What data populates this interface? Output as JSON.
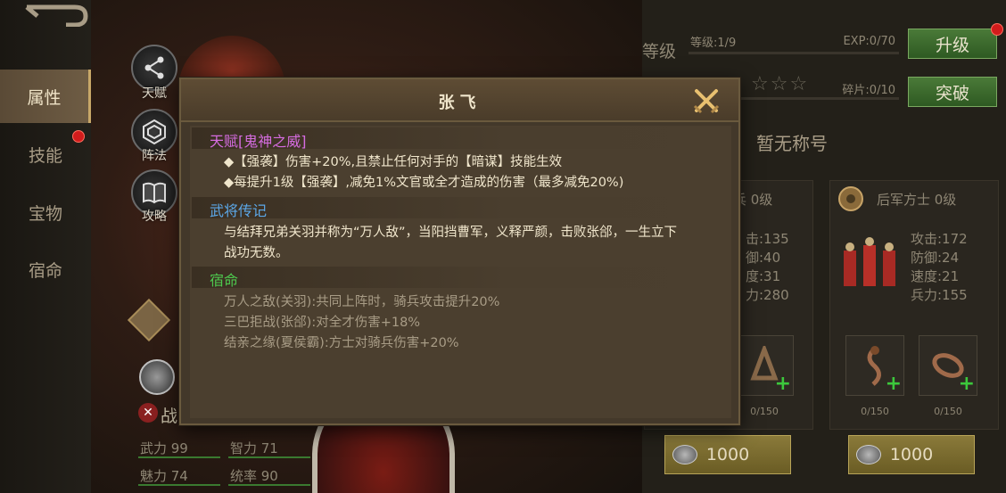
{
  "left_nav": {
    "tabs": [
      {
        "label": "属性",
        "active": true
      },
      {
        "label": "技能",
        "badge": true
      },
      {
        "label": "宝物"
      },
      {
        "label": "宿命"
      }
    ]
  },
  "round_buttons": [
    {
      "label": "天赋",
      "icon": "share-icon"
    },
    {
      "label": "阵法",
      "icon": "hexagon-icon"
    },
    {
      "label": "攻略",
      "icon": "book-icon"
    }
  ],
  "header": {
    "level_label": "等级",
    "level_value": "等级:1/9",
    "exp_value": "EXP:0/70",
    "fragments_value": "碎片:0/10",
    "upgrade_button": "升级",
    "breakthrough_button": "突破",
    "stars_filled": 0,
    "title_text": "暂无称号"
  },
  "troops": [
    {
      "name": "兵 0级",
      "stats": [
        "击:135",
        "御:40",
        "度:31",
        "力:280"
      ],
      "equip_counts": [
        "0/150"
      ],
      "cost": "1000"
    },
    {
      "name": "后军方士 0级",
      "stats": [
        "攻击:172",
        "防御:24",
        "速度:21",
        "兵力:155"
      ],
      "equip_counts": [
        "0/150",
        "0/150"
      ],
      "cost": "1000"
    }
  ],
  "attributes": {
    "battle_label": "战",
    "rows": [
      {
        "left": "武力 99",
        "right": "智力 71"
      },
      {
        "left": "魅力 74",
        "right": "统率 90"
      }
    ]
  },
  "modal": {
    "title": "张飞",
    "talent": {
      "heading": "天赋[鬼神之威]",
      "lines": [
        "◆【强袭】伤害+20%,且禁止任何对手的【暗谋】技能生效",
        "◆每提升1级【强袭】,减免1%文官或全才造成的伤害（最多减免20%)"
      ]
    },
    "biography": {
      "heading": "武将传记",
      "lines": [
        "与结拜兄弟关羽并称为“万人敌”，当阳挡曹军，义释严颜，击败张郃，一生立下",
        "战功无数。"
      ]
    },
    "fate": {
      "heading": "宿命",
      "lines": [
        "万人之敌(关羽):共同上阵时，骑兵攻击提升20%",
        "三巴拒战(张郃):对全才伤害+18%",
        "结亲之缘(夏侯霸):方士对骑兵伤害+20%"
      ]
    }
  },
  "colors": {
    "talent": "#d56ce0",
    "biography": "#5ca8e8",
    "fate": "#4ec84e",
    "modal_bg": "#43382a",
    "button_green": "#3a6a2c"
  }
}
